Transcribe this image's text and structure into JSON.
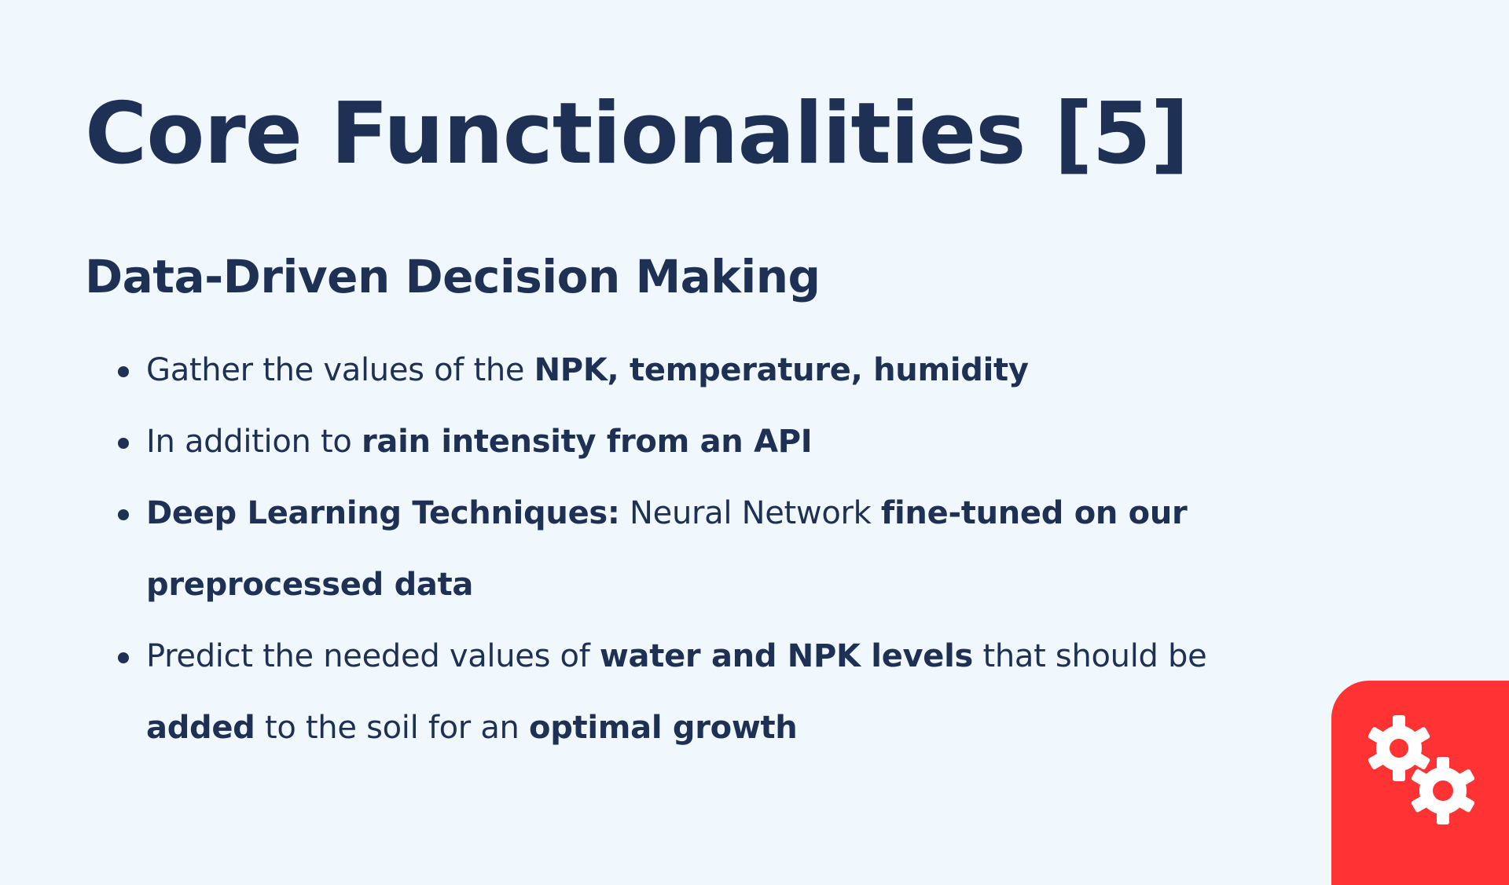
{
  "slide": {
    "title": "Core Functionalities [5]",
    "subtitle": "Data-Driven Decision Making",
    "bullets": [
      {
        "segments": [
          {
            "text": "Gather the values of the ",
            "bold": false
          },
          {
            "text": "NPK, temperature, humidity",
            "bold": true
          }
        ]
      },
      {
        "segments": [
          {
            "text": "In addition to ",
            "bold": false
          },
          {
            "text": "rain intensity from an API",
            "bold": true
          }
        ]
      },
      {
        "segments": [
          {
            "text": "Deep Learning Techniques:",
            "bold": true
          },
          {
            "text": " Neural Network ",
            "bold": false
          },
          {
            "text": "fine-tuned on our preprocessed data",
            "bold": true
          }
        ]
      },
      {
        "segments": [
          {
            "text": "Predict the needed values of ",
            "bold": false
          },
          {
            "text": "water and NPK levels",
            "bold": true
          },
          {
            "text": " that should be ",
            "bold": false
          },
          {
            "text": "added",
            "bold": true
          },
          {
            "text": " to the soil for an ",
            "bold": false
          },
          {
            "text": "optimal growth",
            "bold": true
          }
        ]
      }
    ],
    "badge": {
      "icon": "gears-icon",
      "background_color": "#ff3333",
      "icon_color": "#ffffff"
    }
  }
}
